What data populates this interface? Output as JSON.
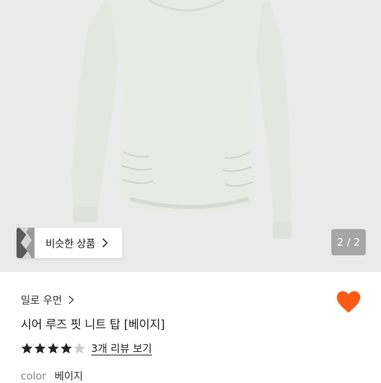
{
  "gallery": {
    "similar_products_label": "비슷한 상품",
    "page_indicator": "2 / 2"
  },
  "product": {
    "brand": "밀로 우먼",
    "title": "시어 루즈 핏 니트 탑 [베이지]",
    "rating": 4,
    "rating_max": 5,
    "review_link": "3개 리뷰 보기",
    "color_label": "color",
    "color_value": "베이지"
  },
  "colors": {
    "heart": "#ff5a14",
    "star_filled": "#222222",
    "star_empty": "#cccccc",
    "garment": "#e6e8e2",
    "background": "#eaeaea"
  },
  "icons": {
    "chip_chevron": "chevron-right-icon",
    "brand_chevron": "chevron-right-icon",
    "favorite": "heart-icon",
    "rating": "star-icon"
  }
}
